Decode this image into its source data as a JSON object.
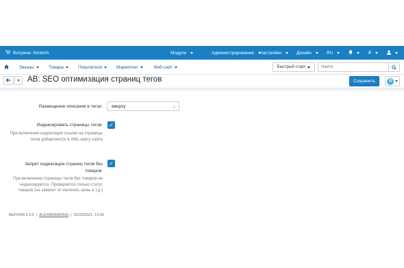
{
  "topbar": {
    "storefront_label": "Витрина: Simtech",
    "menu": [
      "Модули",
      "Администрирование",
      "Настройки",
      "Дизайн",
      "RU",
      "₽"
    ]
  },
  "secondary_nav": {
    "items": [
      "Заказы",
      "Товары",
      "Покупатели",
      "Маркетинг",
      "Веб-сайт"
    ],
    "quick_start_label": "Быстрый старт",
    "search_placeholder": "Найти"
  },
  "page": {
    "title": "AB: SEO оптимизация страниц тегов",
    "save_label": "Сохранить"
  },
  "form": {
    "placement": {
      "label": "Размещение описания в тегах:",
      "value": "вверху"
    },
    "index_tags": {
      "label": "Индексировать страницы тегов:",
      "help": "При включении индексация ссылки на страницы тегов добавляются в XML-карту сайта",
      "checked": true
    },
    "no_index_empty": {
      "label": "Запрет индексации страниц тегов без товаров:",
      "help": "При включении страницы тегов без товаров не индексируются. Проверяется только статус товаров (не зависит от наличия, цены и т.д.)",
      "checked": true
    }
  },
  "footer": {
    "version": "ВЕРСИЯ 2.2.0",
    "separator": "|",
    "vendor": "ALEXBRANDING",
    "date": "02/23/2021, 13:59"
  },
  "colors": {
    "accent": "#1a7fc4",
    "link": "#1c5f9a"
  }
}
